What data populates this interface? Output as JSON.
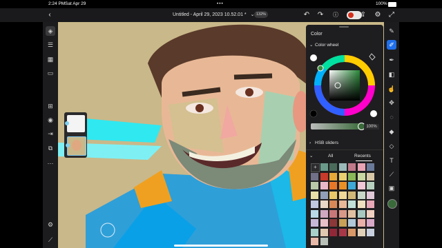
{
  "status": {
    "time": "2:24 PM",
    "date": "Sat Apr 29",
    "battery": "100%"
  },
  "topbar": {
    "title": "Untitled - April 29, 2023 10.52.01",
    "modified": "*",
    "zoom": "132%",
    "more": "•••"
  },
  "color_panel": {
    "title": "Color",
    "color_wheel_label": "Color wheel",
    "opacity": "100%",
    "hsb_label": "HSB sliders",
    "tab_all": "All",
    "tab_recents": "Recents",
    "add_swatch": "+",
    "current_color": "#3a6a3a",
    "swatches": [
      "#6a9a8a",
      "#4a6b5a",
      "#9ab8b8",
      "#c07a8a",
      "#e8a4b4",
      "#6a7a9a",
      "#707088",
      "#c83a2a",
      "#e8a838",
      "#e8d070",
      "#8ab858",
      "#c8d8a0",
      "#d8c8a8",
      "#b8c8a8",
      "#e8b8c8",
      "#e87828",
      "#e89028",
      "#40a8d8",
      "#f0c8d8",
      "#b8d0c0",
      "#e8e0a8",
      "#90a0b8",
      "#e8c868",
      "#f0d898",
      "#d0b878",
      "#c8d8c8",
      "#e0c8d8",
      "#c0c8e0",
      "#e8d8c8",
      "#d88858",
      "#e8b898",
      "#c0e0d8",
      "#f0e0c0",
      "#e8a8b8",
      "#b8d8e8",
      "#d0a8c0",
      "#c87878",
      "#d89888",
      "#e0c0a0",
      "#a8c8c0",
      "#f0d0c0",
      "#c8b8d8",
      "#e8c0c8",
      "#8a3838",
      "#c8a058",
      "#b0c8d8",
      "#e8b0a8",
      "#d8a8c8",
      "#a8d0c8",
      "#e0c8b0",
      "#902838",
      "#a83848",
      "#d89868",
      "#e0d0b8",
      "#c8d0e0",
      "#e8b8a8",
      "#b8c0b8"
    ]
  },
  "tools_left": [
    "layers-icon",
    "adjust-icon",
    "grid-icon",
    "comment-icon",
    "add-layer-icon",
    "visibility-icon",
    "export-layer-icon",
    "lock-icon",
    "more-icon",
    "settings-icon",
    "ruler-icon"
  ],
  "tools_right": [
    "pixel-brush-icon",
    "live-brush-icon",
    "vector-brush-icon",
    "eraser-icon",
    "smudge-icon",
    "move-icon",
    "lasso-icon",
    "fill-icon",
    "eyedropper-icon",
    "text-icon",
    "image-icon",
    "color-icon"
  ]
}
